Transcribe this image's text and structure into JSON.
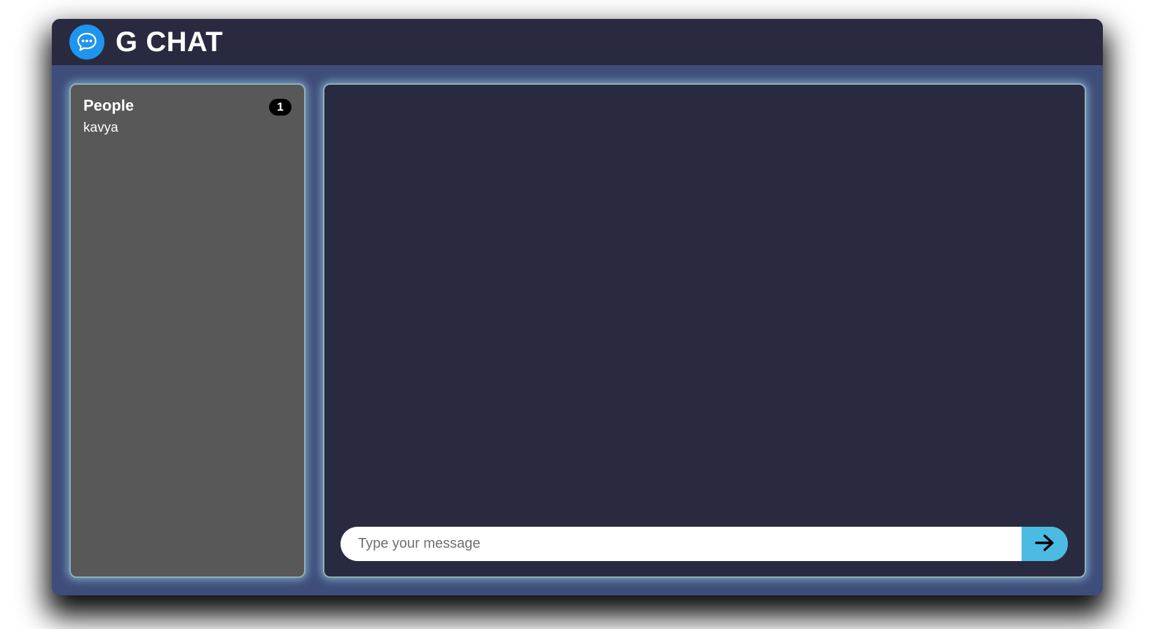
{
  "app": {
    "title": "G CHAT",
    "logo_icon": "chat-bubbles-icon",
    "colors": {
      "header_bg": "#292a3f",
      "app_bg": "#3f4d7a",
      "logo_bg": "#1e95ee",
      "people_panel_bg": "#585858",
      "chat_panel_bg": "#292a3f",
      "send_button_bg": "#4cbbe3"
    }
  },
  "people": {
    "title": "People",
    "count": "1",
    "users": [
      "kavya"
    ]
  },
  "chat": {
    "messages": [],
    "input": {
      "value": "",
      "placeholder": "Type your message"
    },
    "send_icon": "arrow-right-icon"
  }
}
